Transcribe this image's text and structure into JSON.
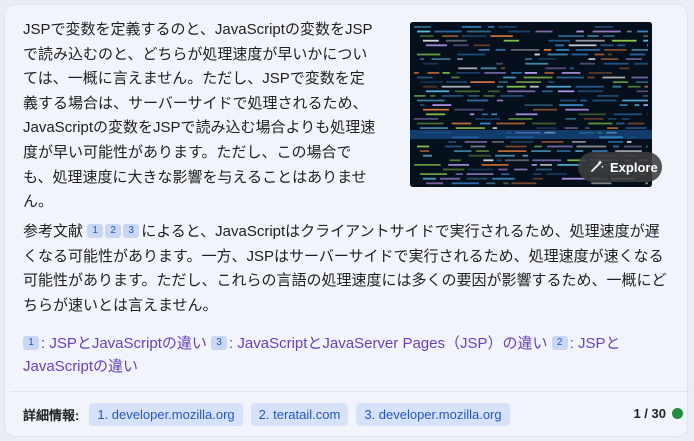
{
  "answer": {
    "paragraph1": "JSPで変数を定義するのと、JavaScriptの変数をJSPで読み込むのと、どちらが処理速度が早いかについては、一概に言えません。ただし、JSPで変数を定義する場合は、サーバーサイドで処理されるため、JavaScriptの変数をJSPで読み込む場合よりも処理速度が早い可能性があります。ただし、この場合でも、処理速度に大きな影響を与えることはありません。",
    "paragraph2_prefix": "参考文献",
    "paragraph2_citations": [
      "1",
      "2",
      "3"
    ],
    "paragraph2_body": "によると、JavaScriptはクライアントサイドで実行されるため、処理速度が遅くなる可能性があります。一方、JSPはサーバーサイドで実行されるため、処理速度が速くなる可能性があります。ただし、これらの言語の処理速度には多くの要因が影響するため、一概にどちらが速いとは言えません。"
  },
  "image": {
    "explore_label": "Explore",
    "icon": "sparkle-wand-icon"
  },
  "references": [
    {
      "num": "1",
      "text": ": JSPとJavaScriptの違い"
    },
    {
      "num": "3",
      "text": ": JavaScriptとJavaServer Pages（JSP）の違い"
    },
    {
      "num": "2",
      "text": ": JSPとJavaScriptの違い"
    }
  ],
  "footer": {
    "label": "詳細情報:",
    "sources": [
      "1. developer.mozilla.org",
      "2. teratail.com",
      "3. developer.mozilla.org"
    ],
    "counter": "1 / 30",
    "status_color": "#1e8e3e"
  }
}
